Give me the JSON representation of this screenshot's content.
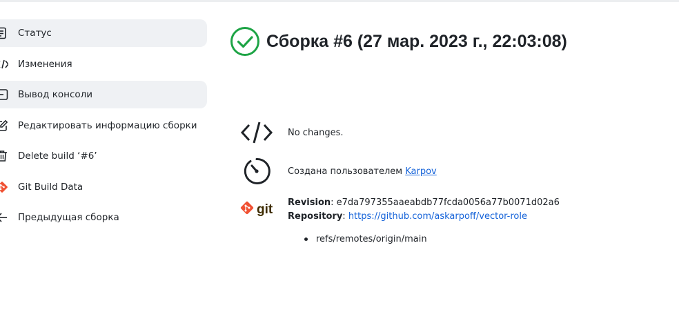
{
  "sidebar": {
    "items": [
      {
        "label": "Статус",
        "icon": "document-icon"
      },
      {
        "label": "Изменения",
        "icon": "code-icon"
      },
      {
        "label": "Вывод консоли",
        "icon": "terminal-icon"
      },
      {
        "label": "Редактировать информацию сборки",
        "icon": "edit-icon"
      },
      {
        "label": "Delete build ‘#6’",
        "icon": "trash-icon"
      },
      {
        "label": "Git Build Data",
        "icon": "git-icon"
      },
      {
        "label": "Предыдущая сборка",
        "icon": "arrow-left-icon"
      }
    ]
  },
  "build": {
    "title": "Сборка #6 (27 мар. 2023 г., 22:03:08)",
    "status_color": "#1ea446"
  },
  "changes": {
    "text": "No changes."
  },
  "cause": {
    "prefix": "Создана пользователем ",
    "user": "Karpov"
  },
  "git": {
    "logo_text": "git",
    "revision_label": "Revision",
    "revision_value": "e7da797355aaeabdb77fcda0056a77b0071d02a6",
    "repository_label": "Repository",
    "repository_url": "https://github.com/askarpoff/vector-role",
    "refs": [
      "refs/remotes/origin/main"
    ]
  }
}
